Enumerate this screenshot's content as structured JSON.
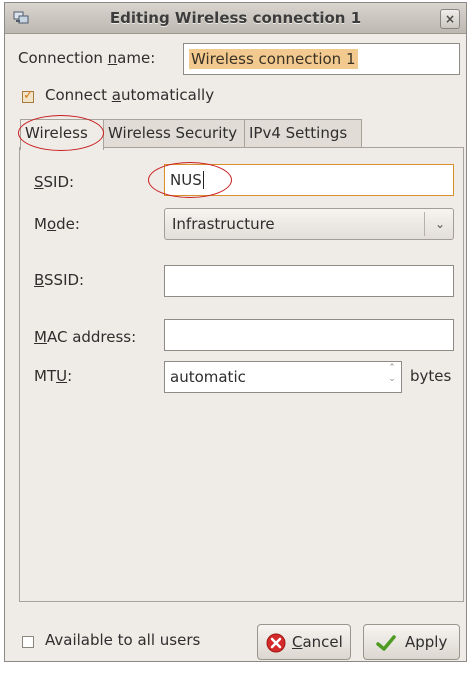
{
  "window": {
    "title": "Editing Wireless connection 1",
    "close_glyph": "×",
    "app_icon": "network-connection-icon"
  },
  "connection_name": {
    "label_pre": "Connection ",
    "label_mnemonic": "n",
    "label_post": "ame:",
    "value": "Wireless connection 1"
  },
  "connect_automatically": {
    "label_pre": "Connect ",
    "label_mnemonic": "a",
    "label_post": "utomatically",
    "checked": true
  },
  "tabs": [
    {
      "label": "Wireless",
      "active": true
    },
    {
      "label": "Wireless Security",
      "active": false
    },
    {
      "label": "IPv4 Settings",
      "active": false
    }
  ],
  "wireless": {
    "ssid": {
      "label_mnemonic": "S",
      "label_post": "SID:",
      "value": "NUS"
    },
    "mode": {
      "label_pre": "M",
      "label_mnemonic": "o",
      "label_post": "de:",
      "value": "Infrastructure",
      "arrow": "⌄"
    },
    "bssid": {
      "label_mnemonic": "B",
      "label_post": "SSID:",
      "value": ""
    },
    "mac": {
      "label_mnemonic": "M",
      "label_post": "AC address:",
      "value": ""
    },
    "mtu": {
      "label_pre": "MT",
      "label_mnemonic": "U",
      "label_post": ":",
      "value": "automatic",
      "unit": "bytes",
      "spin_up": "⌃",
      "spin_down": "⌄"
    }
  },
  "available_to_all_users": {
    "label": "Available to all users",
    "checked": false
  },
  "buttons": {
    "cancel": {
      "label_mnemonic": "C",
      "label_post": "ancel",
      "icon": "cancel-icon"
    },
    "apply": {
      "label": "Apply",
      "icon": "checkmark-icon"
    }
  },
  "colors": {
    "annotation_circle": "#c81f1f",
    "selection": "#f2c98f",
    "check_accent": "#d4801c"
  }
}
